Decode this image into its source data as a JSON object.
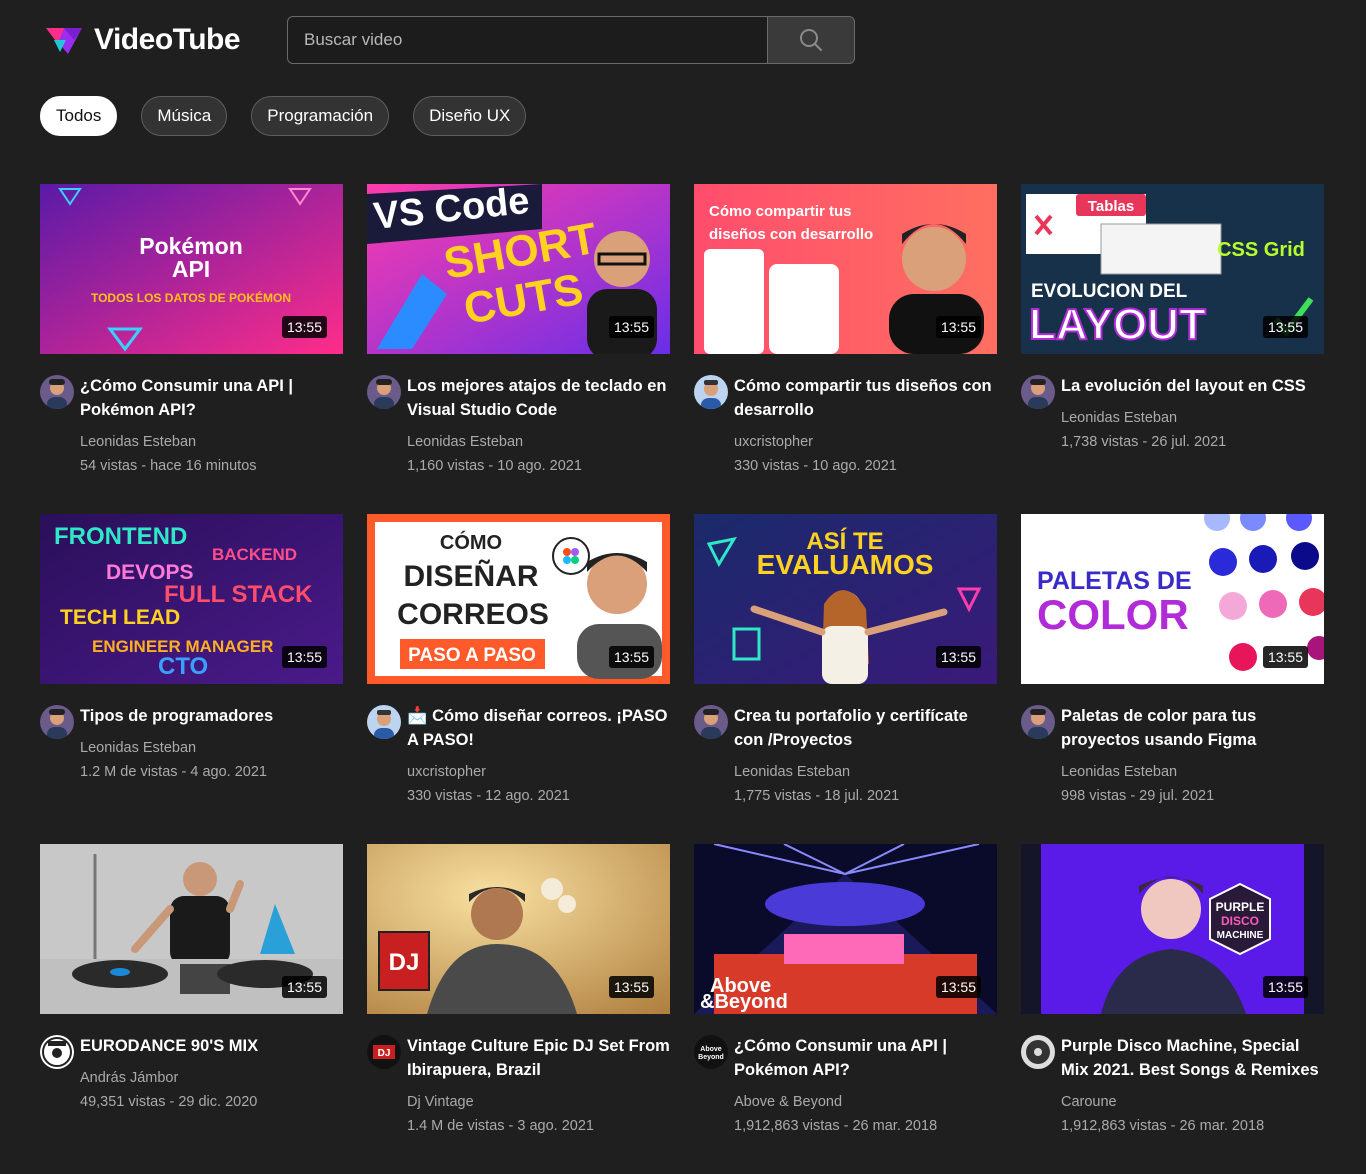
{
  "app": {
    "name": "VideoTube"
  },
  "search": {
    "placeholder": "Buscar video"
  },
  "chips": [
    "Todos",
    "Música",
    "Programación",
    "Diseño UX"
  ],
  "videos": [
    {
      "title": "¿Cómo Consumir una API | Pokémon API?",
      "channel": "Leonidas Esteban",
      "stats": "54 vistas - hace 16 minutos",
      "duration": "13:55",
      "thumb_text": [
        "Pokémon",
        "API",
        "TODOS LOS DATOS DE POKÉMON"
      ]
    },
    {
      "title": "Los mejores atajos de teclado en Visual Studio Code",
      "channel": "Leonidas Esteban",
      "stats": "1,160 vistas - 10 ago. 2021",
      "duration": "13:55",
      "thumb_text": [
        "VS Code",
        "SHORT",
        "CUTS"
      ]
    },
    {
      "title": "Cómo compartir tus diseños con desarrollo",
      "channel": "uxcristopher",
      "stats": "330 vistas - 10 ago. 2021",
      "duration": "13:55",
      "thumb_text": [
        "Cómo compartir tus",
        "diseños con desarrollo"
      ]
    },
    {
      "title": "La evolución del layout en CSS",
      "channel": "Leonidas Esteban",
      "stats": "1,738 vistas - 26 jul. 2021",
      "duration": "13:55",
      "thumb_text": [
        "Tablas",
        "CSS Grid",
        "EVOLUCION DEL",
        "LAYOUT"
      ]
    },
    {
      "title": "Tipos de programadores",
      "channel": "Leonidas Esteban",
      "stats": "1.2 M de vistas - 4 ago. 2021",
      "duration": "13:55",
      "thumb_text": [
        "FRONTEND",
        "BACKEND",
        "DEVOPS",
        "FULL STACK",
        "TECH LEAD",
        "ENGINEER MANAGER",
        "CTO"
      ]
    },
    {
      "title": "📩 Cómo diseñar correos. ¡PASO A PASO!",
      "channel": "uxcristopher",
      "stats": "330 vistas - 12 ago. 2021",
      "duration": "13:55",
      "thumb_text": [
        "CÓMO",
        "DISEÑAR",
        "CORREOS",
        "PASO A PASO"
      ]
    },
    {
      "title": "Crea tu portafolio y certifícate con /Proyectos",
      "channel": "Leonidas Esteban",
      "stats": "1,775 vistas - 18 jul. 2021",
      "duration": "13:55",
      "thumb_text": [
        "ASÍ TE",
        "EVALUAMOS"
      ]
    },
    {
      "title": "Paletas de color para tus proyectos usando Figma",
      "channel": "Leonidas Esteban",
      "stats": "998 vistas - 29 jul. 2021",
      "duration": "13:55",
      "thumb_text": [
        "PALETAS DE",
        "COLOR"
      ]
    },
    {
      "title": "EURODANCE 90'S MIX",
      "channel": "András Jámbor",
      "stats": "49,351 vistas - 29 dic. 2020",
      "duration": "13:55",
      "thumb_text": []
    },
    {
      "title": "Vintage Culture Epic DJ Set From Ibirapuera, Brazil",
      "channel": "Dj Vintage",
      "stats": "1.4 M de vistas - 3 ago. 2021",
      "duration": "13:55",
      "thumb_text": [
        "DJ"
      ]
    },
    {
      "title": "¿Cómo Consumir una API | Pokémon API?",
      "channel": "Above & Beyond",
      "stats": "1,912,863 vistas - 26 mar. 2018",
      "duration": "13:55",
      "thumb_text": [
        "Above",
        "&Beyond"
      ]
    },
    {
      "title": "Purple Disco Machine, Special Mix 2021. Best Songs & Remixes",
      "channel": "Caroune",
      "stats": "1,912,863 vistas - 26 mar. 2018",
      "duration": "13:55",
      "thumb_text": [
        "PURPLE",
        "DISCO",
        "MACHINE"
      ]
    }
  ]
}
